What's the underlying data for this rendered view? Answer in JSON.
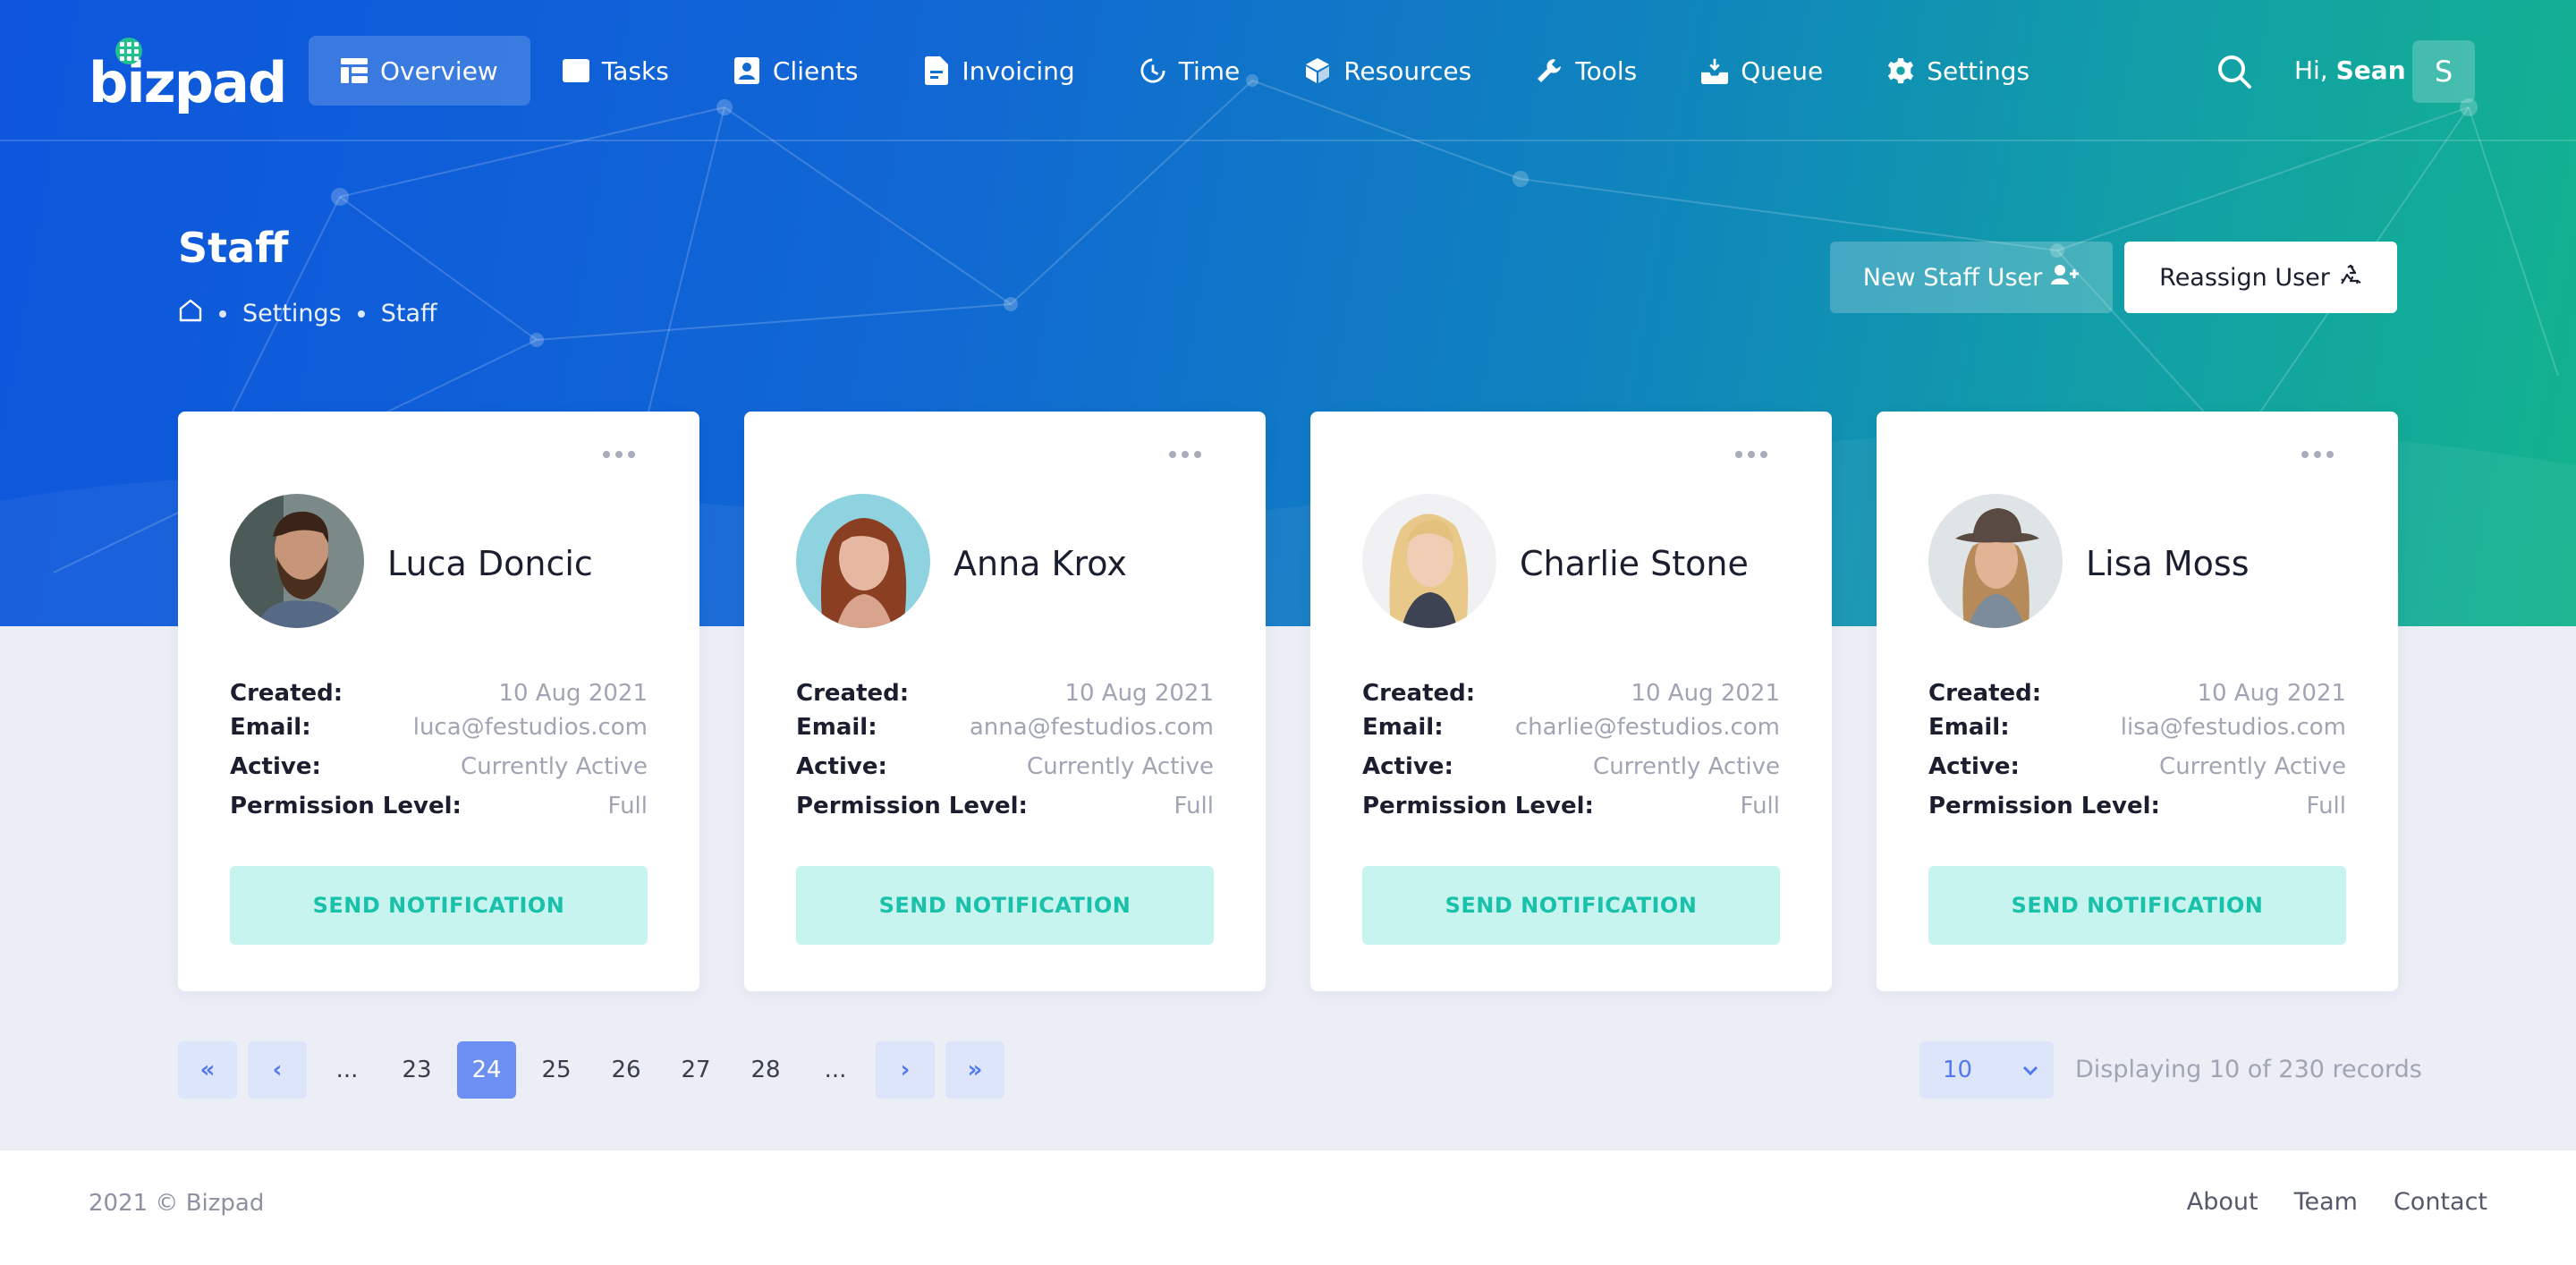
{
  "app": {
    "logo_text": "bizpad"
  },
  "nav": {
    "items": [
      {
        "label": "Overview",
        "icon": "overview-icon",
        "active": true
      },
      {
        "label": "Tasks",
        "icon": "tasks-icon"
      },
      {
        "label": "Clients",
        "icon": "clients-icon"
      },
      {
        "label": "Invoicing",
        "icon": "invoice-icon"
      },
      {
        "label": "Time",
        "icon": "clock-icon"
      },
      {
        "label": "Resources",
        "icon": "cube-icon"
      },
      {
        "label": "Tools",
        "icon": "wrench-icon"
      },
      {
        "label": "Queue",
        "icon": "inbox-icon"
      },
      {
        "label": "Settings",
        "icon": "gear-icon"
      }
    ]
  },
  "user": {
    "greeting_prefix": "Hi,",
    "name": "Sean",
    "initial": "S"
  },
  "page": {
    "title": "Staff",
    "breadcrumb": [
      "Settings",
      "Staff"
    ]
  },
  "actions": {
    "new_staff_label": "New Staff User",
    "reassign_label": "Reassign User"
  },
  "labels": {
    "created": "Created:",
    "email": "Email:",
    "active": "Active:",
    "permission": "Permission Level:",
    "send": "SEND NOTIFICATION"
  },
  "staff": [
    {
      "name": "Luca Doncic",
      "created": "10 Aug 2021",
      "email": "luca@festudios.com",
      "active": "Currently Active",
      "permission": "Full"
    },
    {
      "name": "Anna Krox",
      "created": "10 Aug 2021",
      "email": "anna@festudios.com",
      "active": "Currently Active",
      "permission": "Full"
    },
    {
      "name": "Charlie Stone",
      "created": "10 Aug 2021",
      "email": "charlie@festudios.com",
      "active": "Currently Active",
      "permission": "Full"
    },
    {
      "name": "Lisa Moss",
      "created": "10 Aug 2021",
      "email": "lisa@festudios.com",
      "active": "Currently Active",
      "permission": "Full"
    }
  ],
  "pagination": {
    "first": "«",
    "prev": "‹",
    "next": "›",
    "last": "»",
    "ellipsis": "...",
    "pages": [
      "23",
      "24",
      "25",
      "26",
      "27",
      "28"
    ],
    "current": "24",
    "per_page": "10",
    "records_text": "Displaying 10 of 230 records"
  },
  "footer": {
    "copyright": "2021 © Bizpad",
    "links": [
      "About",
      "Team",
      "Contact"
    ]
  },
  "colors": {
    "accent": "#6c8ff2",
    "notify_bg": "#c8f4ef",
    "notify_text": "#19c0aa",
    "hero_start": "#0d56dd",
    "hero_end": "#13b38d"
  }
}
